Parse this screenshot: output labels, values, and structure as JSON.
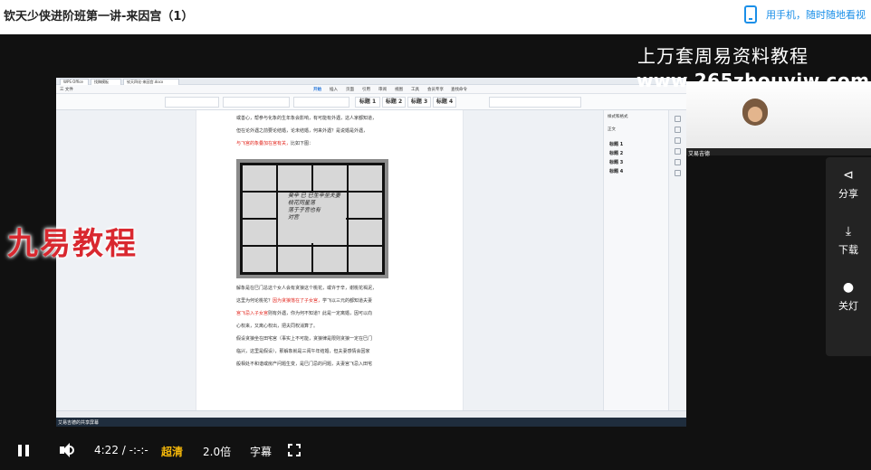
{
  "page": {
    "title": "钦天少侠进阶班第一讲-来因宫（1）",
    "mobile_tip": "用手机，随时随地看视"
  },
  "watermarks": {
    "line1": "上万套周易资料教程",
    "line2": "www.265zhouyiw.com",
    "logo": "九易教程"
  },
  "webcam": {
    "name": "艾易吉德"
  },
  "side_menu": [
    {
      "icon": "share-icon",
      "label": "分享"
    },
    {
      "icon": "download-icon",
      "label": "下载"
    },
    {
      "icon": "bulb-icon",
      "label": "关灯"
    }
  ],
  "app": {
    "tabs": [
      "WPS Office",
      "找稿模板",
      "钦天四化-来因宫.docx"
    ],
    "menu": [
      "三 文件",
      "开始",
      "插入",
      "页面",
      "引用",
      "审阅",
      "视图",
      "工具",
      "会员专享",
      "查找命令"
    ],
    "menu_active": "开始",
    "styles": [
      "标题 1",
      "标题 2",
      "标题 3",
      "标题 4"
    ],
    "doc_lines": [
      {
        "a": "或善心，帮参与化象的生年象会影响，有可能有外遇，这人家都知道，",
        "r": "",
        "b": ""
      },
      {
        "a": "但在论外遇之前要论结婚，论未结婚，何来外遇？是说婚是外遇，",
        "r": "",
        "b": ""
      },
      {
        "a": "",
        "r": "与飞宫的象叠加在宫有关，",
        "b": "比如下图："
      }
    ],
    "handwriting": [
      "癸辛  巳  巳生辛坐夫妻",
      "桃花同星落",
      "落于子宫也有",
      "对宫"
    ],
    "doc_lines2": [
      {
        "a": "解象是在巳门总这个女人会有贪狼这个桃花，或许于辛，谢桃花褐泥，",
        "r": "",
        "b": ""
      },
      {
        "a": "这里为何论桃花？",
        "r": "因为贪狼落在了子女宫，",
        "b": "学飞以三元的都知道夫妻"
      },
      {
        "a": "",
        "r": "宫飞忌入子女宫",
        "b": "则有外遇，你为何不知道？此是一定离婚，因可以向"
      },
      {
        "a": "心权来，又离心权出，把夫同权消算了。",
        "r": "",
        "b": ""
      },
      {
        "a": "假设贪狼坐在田宅宫（事实上不可能，贪狼律是限则贪狼一定在巳门",
        "r": "",
        "b": ""
      },
      {
        "a": "临兴，这里是假设），那解象就是三阅午年结婚，但夫妻感情会因家",
        "r": "",
        "b": ""
      },
      {
        "a": "般相处不和谐或房产问题生变，是巳门忌的问题，夫妻宫飞忌入田宅",
        "r": "",
        "b": ""
      }
    ],
    "panel_title": "样式和格式",
    "panel_items": [
      "正文",
      "标题 1",
      "标题 2",
      "标题 3",
      "标题 4"
    ],
    "taskbar_label": "艾易吉德的共享屏幕"
  },
  "player": {
    "time": "4:22 / -:-:-",
    "quality": "超清",
    "speed": "2.0倍",
    "subtitle": "字幕"
  }
}
